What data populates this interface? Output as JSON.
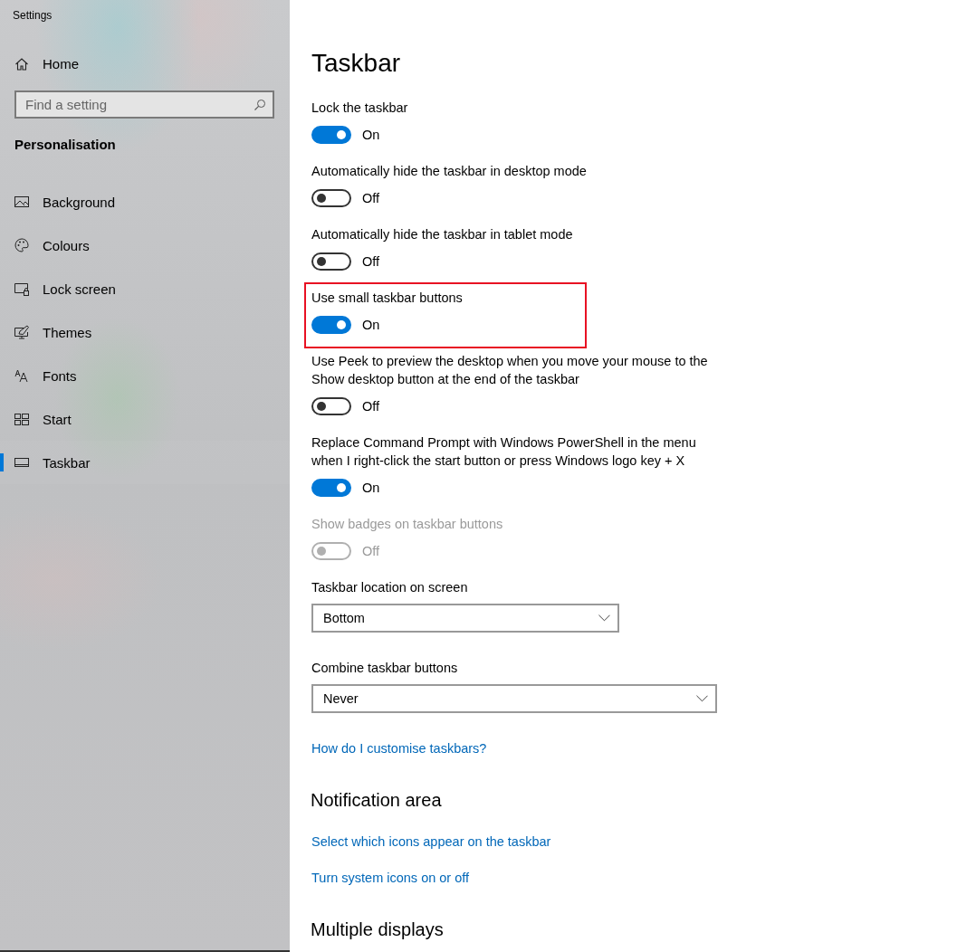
{
  "window": {
    "title": "Settings"
  },
  "sidebar": {
    "home": "Home",
    "search": {
      "placeholder": "Find a setting"
    },
    "section": "Personalisation",
    "items": [
      {
        "label": "Background",
        "selected": false
      },
      {
        "label": "Colours",
        "selected": false
      },
      {
        "label": "Lock screen",
        "selected": false
      },
      {
        "label": "Themes",
        "selected": false
      },
      {
        "label": "Fonts",
        "selected": false
      },
      {
        "label": "Start",
        "selected": false
      },
      {
        "label": "Taskbar",
        "selected": true
      }
    ]
  },
  "page": {
    "title": "Taskbar",
    "items": [
      {
        "kind": "toggle",
        "label": "Lock the taskbar",
        "on": true,
        "disabled": false,
        "highlighted": false,
        "state_text": "On"
      },
      {
        "kind": "toggle",
        "label": "Automatically hide the taskbar in desktop mode",
        "on": false,
        "disabled": false,
        "highlighted": false,
        "state_text": "Off"
      },
      {
        "kind": "toggle",
        "label": "Automatically hide the taskbar in tablet mode",
        "on": false,
        "disabled": false,
        "highlighted": false,
        "state_text": "Off"
      },
      {
        "kind": "toggle",
        "label": "Use small taskbar buttons",
        "on": true,
        "disabled": false,
        "highlighted": true,
        "state_text": "On"
      },
      {
        "kind": "toggle",
        "label": "Use Peek to preview the desktop when you move your mouse to the Show desktop button at the end of the taskbar",
        "on": false,
        "disabled": false,
        "highlighted": false,
        "state_text": "Off"
      },
      {
        "kind": "toggle",
        "label": "Replace Command Prompt with Windows PowerShell in the menu when I right-click the start button or press Windows logo key + X",
        "on": true,
        "disabled": false,
        "highlighted": false,
        "state_text": "On"
      },
      {
        "kind": "toggle",
        "label": "Show badges on taskbar buttons",
        "on": false,
        "disabled": true,
        "highlighted": false,
        "state_text": "Off"
      },
      {
        "kind": "dropdown",
        "label": "Taskbar location on screen",
        "value": "Bottom"
      },
      {
        "kind": "dropdown",
        "label": "Combine taskbar buttons",
        "value": "Never"
      },
      {
        "kind": "link",
        "label": "How do I customise taskbars?"
      },
      {
        "kind": "heading",
        "label": "Notification area"
      },
      {
        "kind": "link",
        "label": "Select which icons appear on the taskbar"
      },
      {
        "kind": "link",
        "label": "Turn system icons on or off"
      },
      {
        "kind": "heading",
        "label": "Multiple displays"
      }
    ]
  }
}
